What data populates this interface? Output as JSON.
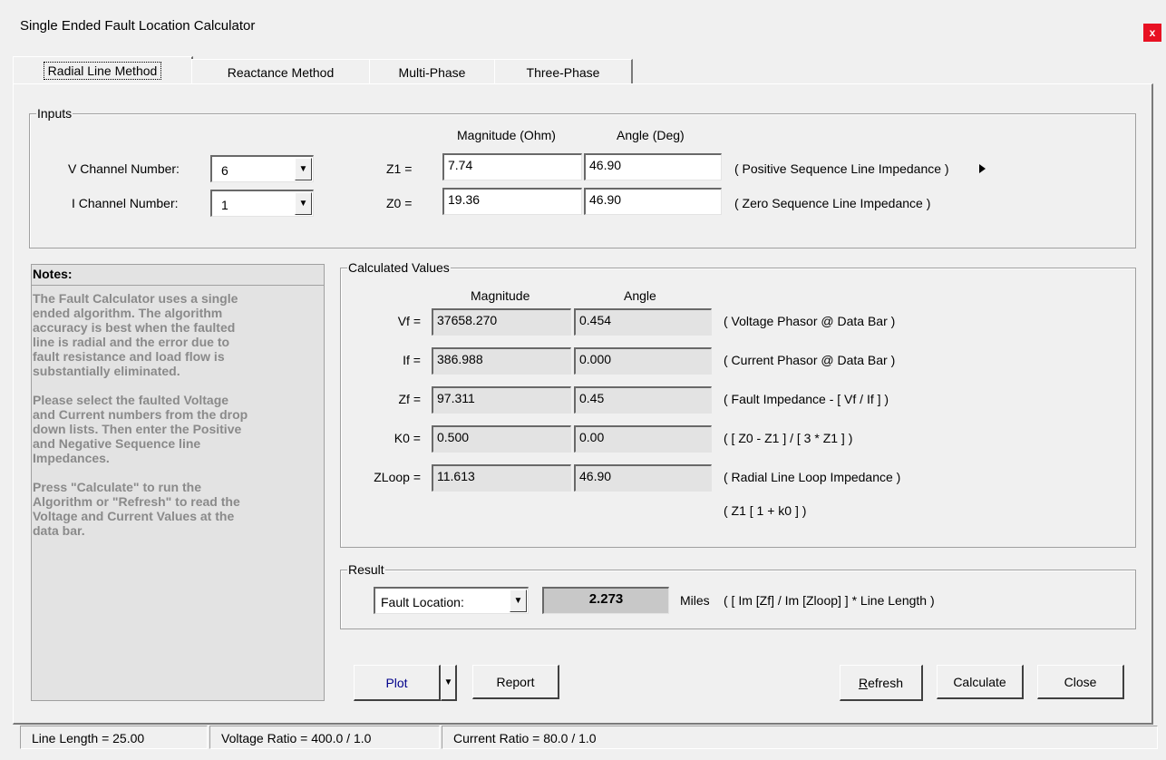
{
  "window": {
    "title": "Single Ended Fault Location Calculator",
    "close_glyph": "x"
  },
  "tabs": [
    {
      "label": "Radial Line Method",
      "active": true
    },
    {
      "label": "Reactance Method",
      "active": false
    },
    {
      "label": "Multi-Phase",
      "active": false
    },
    {
      "label": "Three-Phase",
      "active": false
    }
  ],
  "inputs": {
    "legend": "Inputs",
    "col_magnitude": "Magnitude (Ohm)",
    "col_angle": "Angle (Deg)",
    "v_channel": {
      "label": "V Channel Number:",
      "value": "6"
    },
    "i_channel": {
      "label": "I Channel Number:",
      "value": "1"
    },
    "z1": {
      "label": "Z1 =",
      "magnitude": "7.74",
      "angle": "46.90",
      "desc": "( Positive Sequence Line Impedance )",
      "arrow_icon": "play-right-icon"
    },
    "z0": {
      "label": "Z0 =",
      "magnitude": "19.36",
      "angle": "46.90",
      "desc": "( Zero Sequence Line Impedance )"
    }
  },
  "notes": {
    "title": "Notes:",
    "text": "The Fault Calculator uses a single\nended algorithm. The algorithm\naccuracy is best when the faulted\nline is radial and the error due to\nfault resistance and load flow is\nsubstantially eliminated.\n\nPlease select the faulted Voltage\nand Current numbers from the drop\ndown lists. Then enter the Positive\nand Negative Sequence line\nImpedances.\n\nPress \"Calculate\" to run the\nAlgorithm or \"Refresh\" to read the\nVoltage and Current Values at the\ndata bar."
  },
  "calculated": {
    "legend": "Calculated Values",
    "col_magnitude": "Magnitude",
    "col_angle": "Angle",
    "rows": [
      {
        "label": "Vf =",
        "magnitude": "37658.270",
        "angle": "0.454",
        "desc": "( Voltage Phasor @ Data Bar )"
      },
      {
        "label": "If =",
        "magnitude": "386.988",
        "angle": "0.000",
        "desc": "( Current Phasor @ Data Bar )"
      },
      {
        "label": "Zf =",
        "magnitude": "97.311",
        "angle": "0.45",
        "desc": "( Fault Impedance - [ Vf / If ] )"
      },
      {
        "label": "K0 =",
        "magnitude": "0.500",
        "angle": "0.00",
        "desc": "( [ Z0 - Z1 ] / [ 3 * Z1 ] )"
      },
      {
        "label": "ZLoop =",
        "magnitude": "11.613",
        "angle": "46.90",
        "desc": "( Radial Line Loop Impedance )"
      }
    ],
    "zloop_extra": "( Z1 [ 1 + k0 ] )"
  },
  "result": {
    "legend": "Result",
    "selector": "Fault Location:",
    "value": "2.273",
    "units": "Miles",
    "formula": "( [ Im [Zf] / Im [Zloop] ] * Line Length )"
  },
  "buttons": {
    "plot": "Plot",
    "report": "Report",
    "refresh_r": "R",
    "refresh_rest": "efresh",
    "calculate": "Calculate",
    "close": "Close"
  },
  "status": {
    "line_length": "Line Length = 25.00",
    "voltage_ratio": "Voltage Ratio = 400.0 / 1.0",
    "current_ratio": "Current Ratio = 80.0 / 1.0"
  },
  "colors": {
    "plot_text": "#00008b",
    "close_red": "#e81123"
  }
}
